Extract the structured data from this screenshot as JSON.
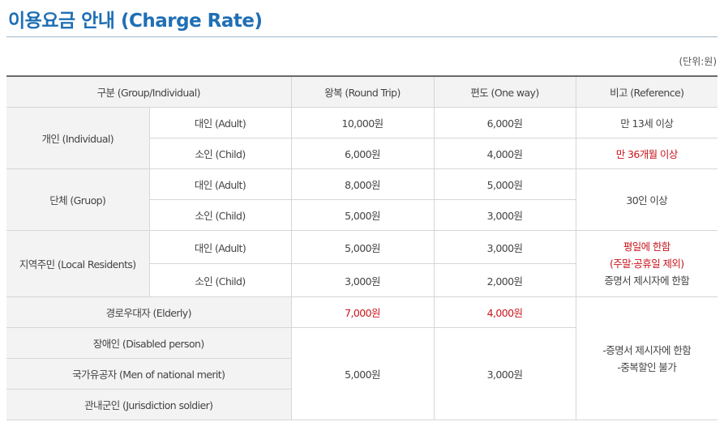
{
  "page": {
    "title": "이용요금 안내 (Charge Rate)",
    "unit": "(단위:원)"
  },
  "table": {
    "headers": {
      "category": "구분 (Group/Individual)",
      "round_trip": "왕복 (Round Trip)",
      "one_way": "편도 (One way)",
      "reference": "비고 (Reference)"
    },
    "individual": {
      "label": "개인 (Individual)",
      "adult": {
        "label": "대인 (Adult)",
        "round_trip": "10,000원",
        "one_way": "6,000원",
        "note": "만 13세 이상"
      },
      "child": {
        "label": "소인 (Child)",
        "round_trip": "6,000원",
        "one_way": "4,000원",
        "note": "만 36개월 이상"
      }
    },
    "group": {
      "label": "단체 (Gruop)",
      "adult": {
        "label": "대인 (Adult)",
        "round_trip": "8,000원",
        "one_way": "5,000원"
      },
      "child": {
        "label": "소인 (Child)",
        "round_trip": "5,000원",
        "one_way": "3,000원"
      },
      "note": "30인 이상"
    },
    "residents": {
      "label": "지역주민 (Local Residents)",
      "adult": {
        "label": "대인 (Adult)",
        "round_trip": "5,000원",
        "one_way": "3,000원"
      },
      "child": {
        "label": "소인 (Child)",
        "round_trip": "3,000원",
        "one_way": "2,000원"
      },
      "note_line1": "평일에 한함",
      "note_line2": "(주말·공휴일 제외)",
      "note_line3": "증명서 제시자에 한함"
    },
    "elderly": {
      "label": "경로우대자 (Elderly)",
      "round_trip": "7,000원",
      "one_way": "4,000원"
    },
    "disabled": {
      "label": "장애인 (Disabled person)"
    },
    "merit": {
      "label": "국가유공자 (Men of national merit)"
    },
    "soldier": {
      "label": "관내군인 (Jurisdiction soldier)"
    },
    "special_round_trip": "5,000원",
    "special_one_way": "3,000원",
    "special_note_line1": "-증명서 제시자에 한함",
    "special_note_line2": "-중복할인 불가"
  },
  "colors": {
    "title": "#1f6fb5",
    "highlight": "#c8161d",
    "header_bg": "#f3f3f3",
    "border": "#d6d6d6"
  }
}
